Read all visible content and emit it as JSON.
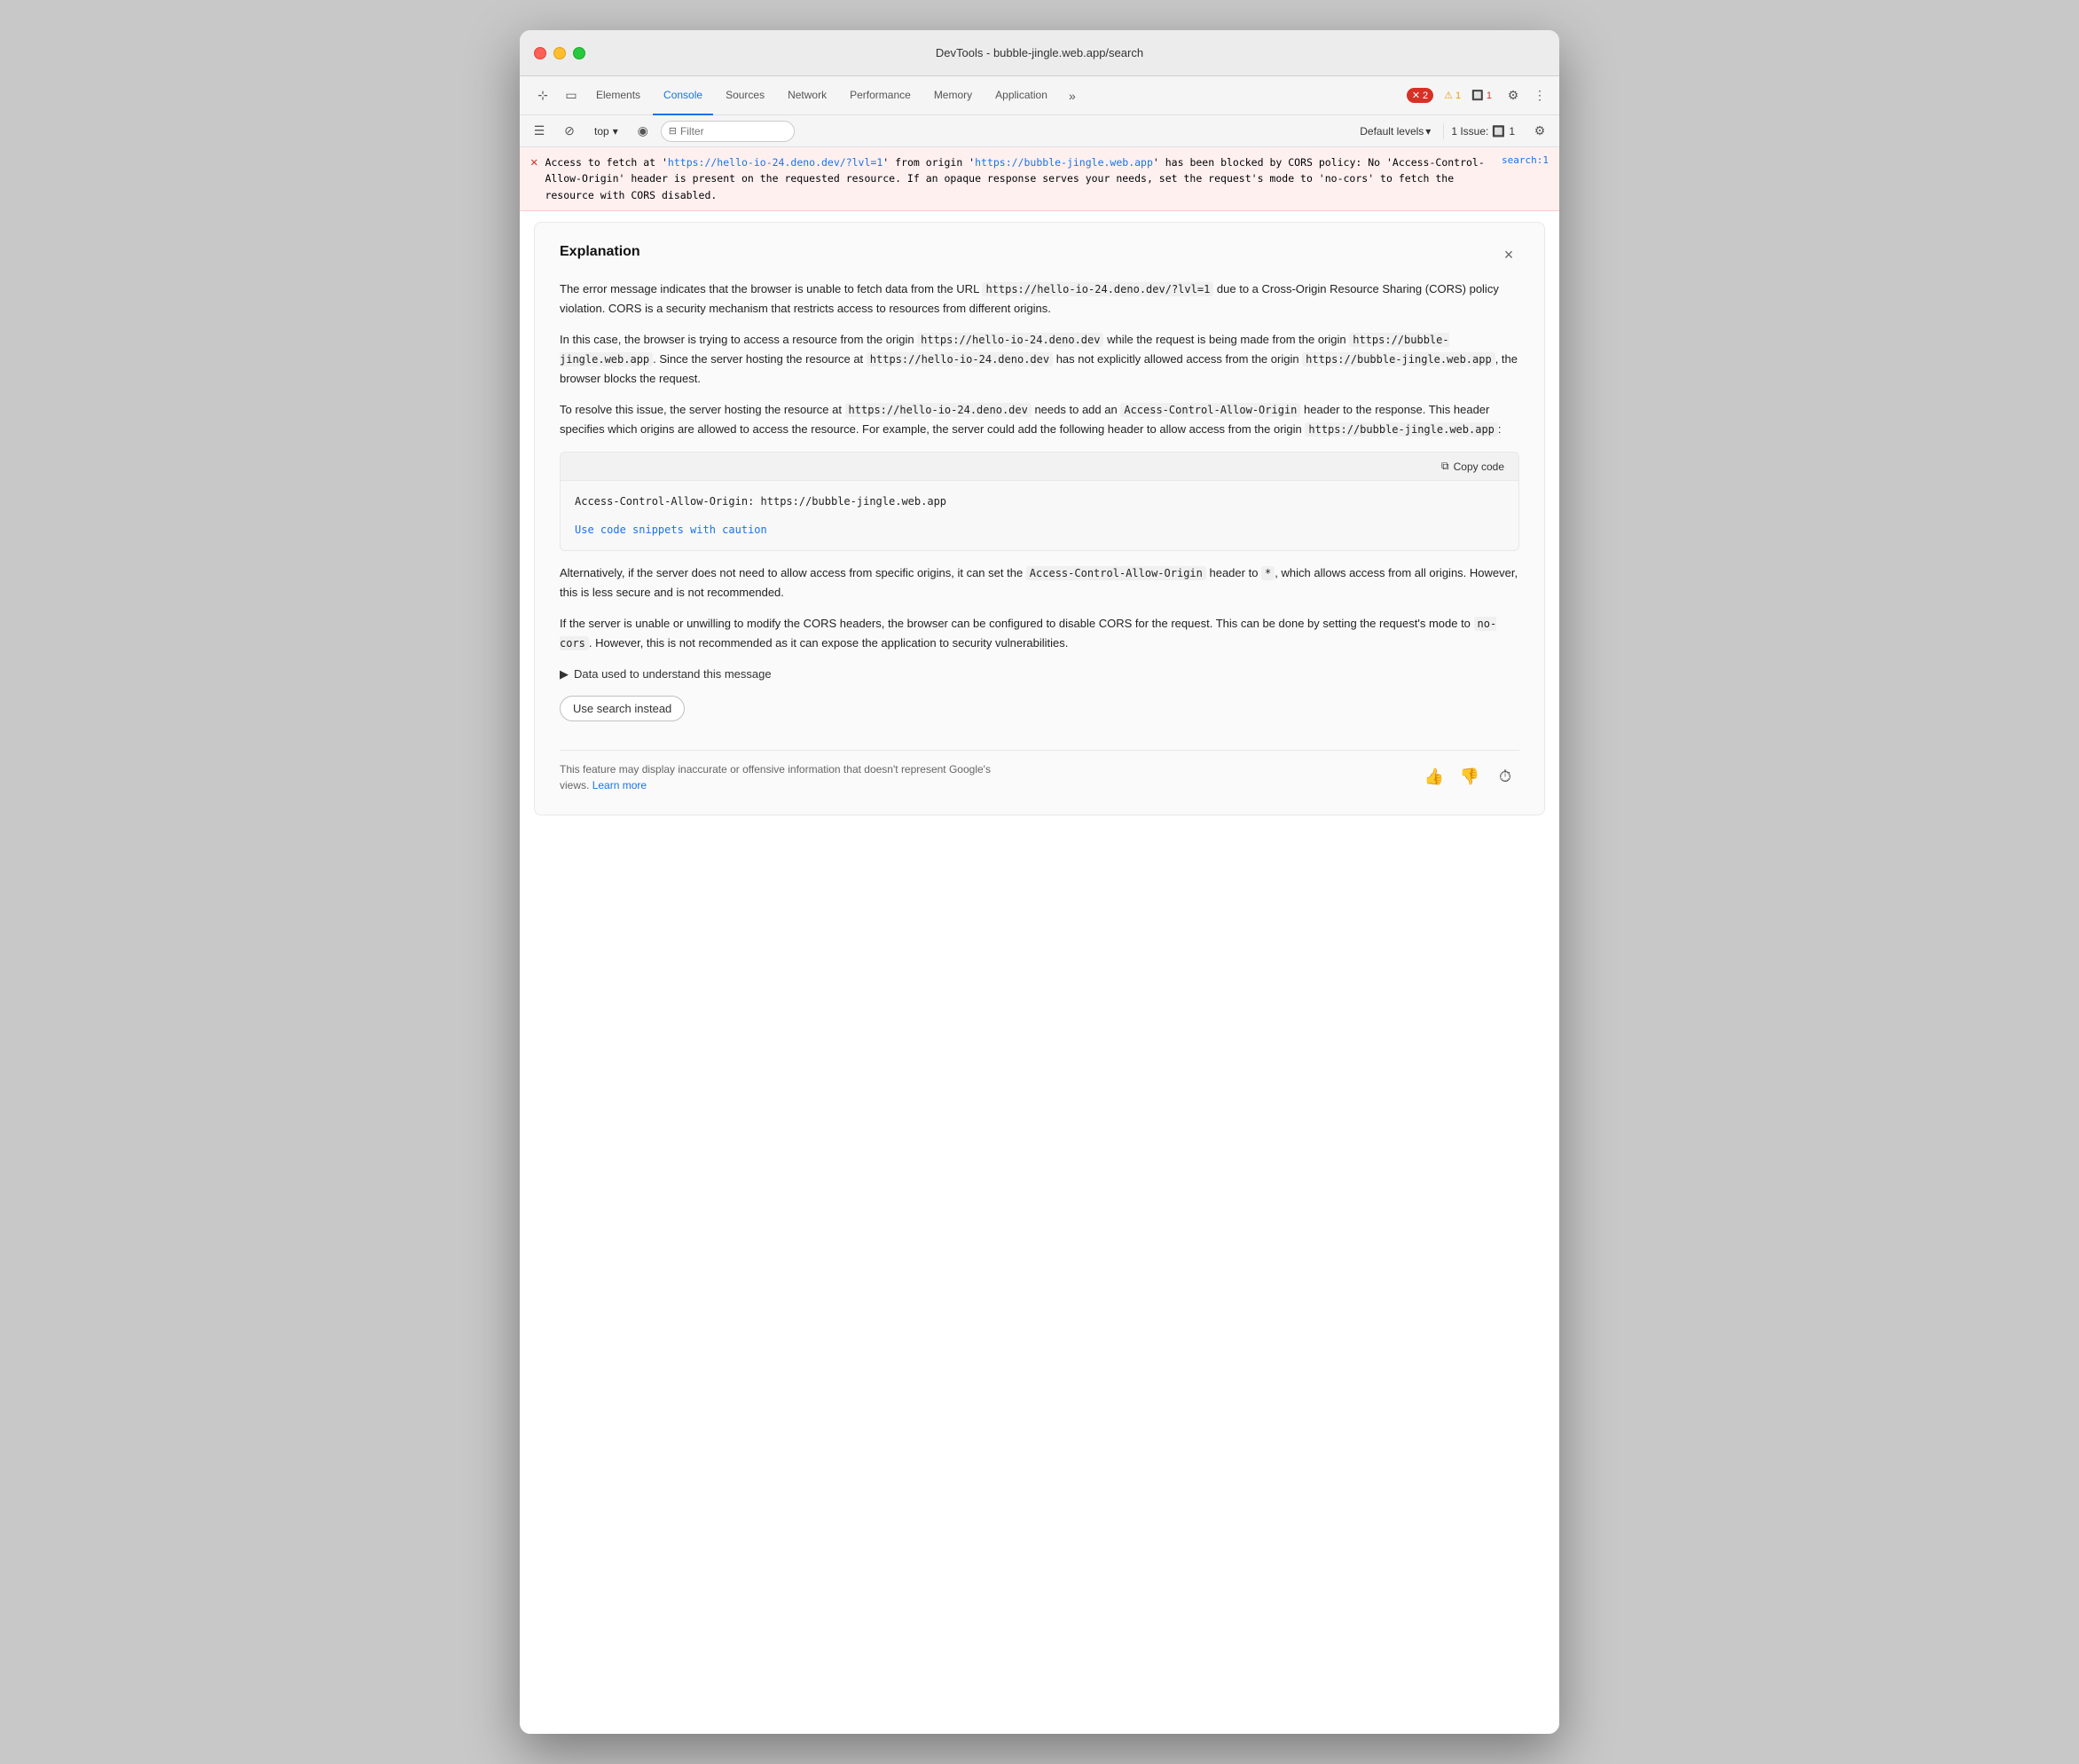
{
  "window": {
    "title": "DevTools - bubble-jingle.web.app/search"
  },
  "tabs": [
    {
      "label": "Elements",
      "active": false
    },
    {
      "label": "Console",
      "active": true
    },
    {
      "label": "Sources",
      "active": false
    },
    {
      "label": "Network",
      "active": false
    },
    {
      "label": "Performance",
      "active": false
    },
    {
      "label": "Memory",
      "active": false
    },
    {
      "label": "Application",
      "active": false
    }
  ],
  "badges": {
    "error_count": "2",
    "warn_count": "1",
    "issue_count": "1"
  },
  "sub_toolbar": {
    "context_label": "top",
    "filter_placeholder": "Filter",
    "levels_label": "Default levels",
    "issues_label": "1 Issue:"
  },
  "console": {
    "error_url1": "https://hello-io-24.deno.dev/?lvl=1",
    "error_url2": "https://bubble-jingle.web.app",
    "error_message": "Access to fetch at 'https://hello-io-24.deno.dev/?lvl=1' from origin 'https://bubble-jingle.web.app' has been blocked by CORS policy: No 'Access-Control-Allow-Origin' header is present on the requested resource. If an opaque response serves your needs, set the request's mode to 'no-cors' to fetch the resource with CORS disabled.",
    "error_source": "search:1"
  },
  "explanation": {
    "title": "Explanation",
    "para1": "The error message indicates that the browser is unable to fetch data from the URL https://hello-io-24.deno.dev/?lvl=1 due to a Cross-Origin Resource Sharing (CORS) policy violation. CORS is a security mechanism that restricts access to resources from different origins.",
    "para1_url": "https://hello-io-24.deno.dev/?lvl=1",
    "para2_part1": "In this case, the browser is trying to access a resource from the origin",
    "para2_url1": "https://hello-io-24.deno.dev",
    "para2_part2": "while the request is being made from the origin",
    "para2_url2": "https://bubble-jingle.web.app",
    "para2_part3": ". Since the server hosting the resource at",
    "para2_url3": "https://hello-io-24.deno.dev",
    "para2_part4": "has not explicitly allowed access from the origin",
    "para2_url4": "https://bubble-jingle.web.app",
    "para2_end": ", the browser blocks the request.",
    "para3_part1": "To resolve this issue, the server hosting the resource at",
    "para3_url": "https://hello-io-24.deno.dev",
    "para3_part2": "needs to add an",
    "para3_code1": "Access-Control-Allow-Origin",
    "para3_part3": "header to the response. This header specifies which origins are allowed to access the resource. For example, the server could add the following header to allow access from the origin",
    "para3_url2": "https://bubble-jingle.web.app",
    "para3_end": ":",
    "code_snippet": "Access-Control-Allow-Origin: https://bubble-jingle.web.app",
    "copy_code_label": "Copy code",
    "code_caution_label": "Use code snippets with caution",
    "para4_part1": "Alternatively, if the server does not need to allow access from specific origins, it can set the",
    "para4_code": "Access-Control-Allow-Origin",
    "para4_part2": "header to",
    "para4_code2": "*",
    "para4_end": ", which allows access from all origins. However, this is less secure and is not recommended.",
    "para5": "If the server is unable or unwilling to modify the CORS headers, the browser can be configured to disable CORS for the request. This can be done by setting the request's mode to",
    "para5_code": "no-cors",
    "para5_end": ". However, this is not recommended as it can expose the application to security vulnerabilities.",
    "data_used_label": "Data used to understand this message",
    "use_search_label": "Use search instead",
    "disclaimer": "This feature may display inaccurate or offensive information that doesn't represent Google's views.",
    "learn_more": "Learn more"
  }
}
